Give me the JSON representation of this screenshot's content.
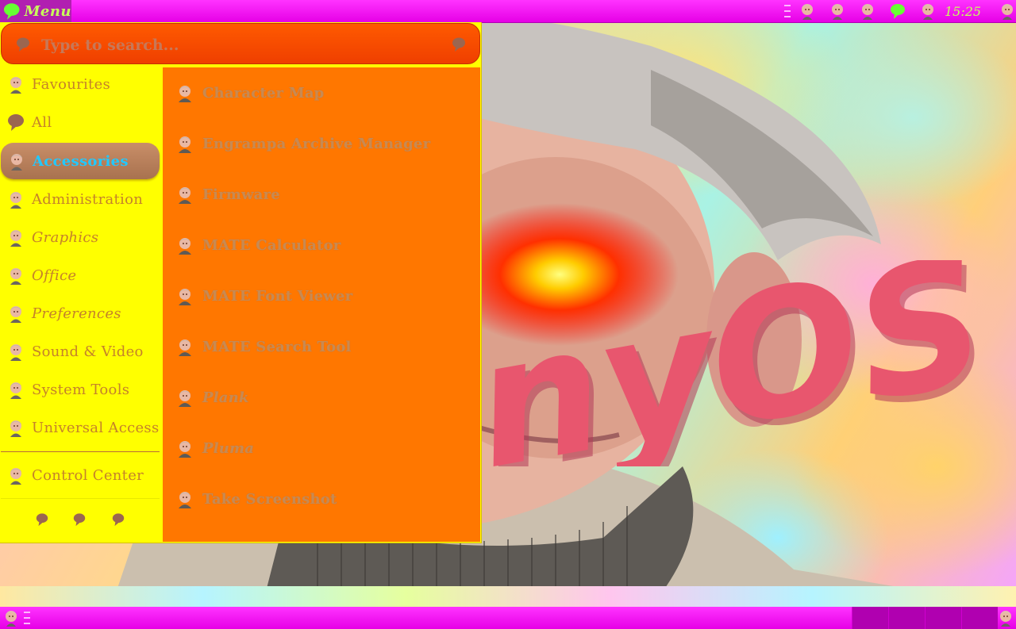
{
  "top_panel": {
    "menu_label": "Menu",
    "clock": "15:25"
  },
  "menu": {
    "search_placeholder": "Type to search...",
    "categories": [
      {
        "label": "Favourites"
      },
      {
        "label": "All"
      },
      {
        "label": "Accessories"
      },
      {
        "label": "Administration"
      },
      {
        "label": "Graphics"
      },
      {
        "label": "Office"
      },
      {
        "label": "Preferences"
      },
      {
        "label": "Sound & Video"
      },
      {
        "label": "System Tools"
      },
      {
        "label": "Universal Access"
      }
    ],
    "control_center": "Control Center",
    "active_category": "Accessories",
    "apps": [
      {
        "label": "Character Map"
      },
      {
        "label": "Engrampa Archive Manager"
      },
      {
        "label": "Firmware"
      },
      {
        "label": "MATE Calculator"
      },
      {
        "label": "MATE Font Viewer"
      },
      {
        "label": "MATE Search Tool"
      },
      {
        "label": "Plank"
      },
      {
        "label": "Pluma"
      },
      {
        "label": "Take Screenshot"
      }
    ]
  },
  "wallpaper": {
    "logo_text": "nyOS"
  },
  "colors": {
    "panel": "#ff00ff",
    "menu_bg": "#ffff00",
    "search_bg": "#ff4a00",
    "apps_bg": "#ff7700",
    "active_text": "#22c8ff",
    "label_text": "#c5822a"
  },
  "icons": {
    "menu": "speech-bubble-icon",
    "tray": [
      "face-icon",
      "face-icon",
      "face-icon",
      "bubble-icon",
      "face-icon"
    ],
    "category": "face-icon",
    "app": "face-icon"
  }
}
